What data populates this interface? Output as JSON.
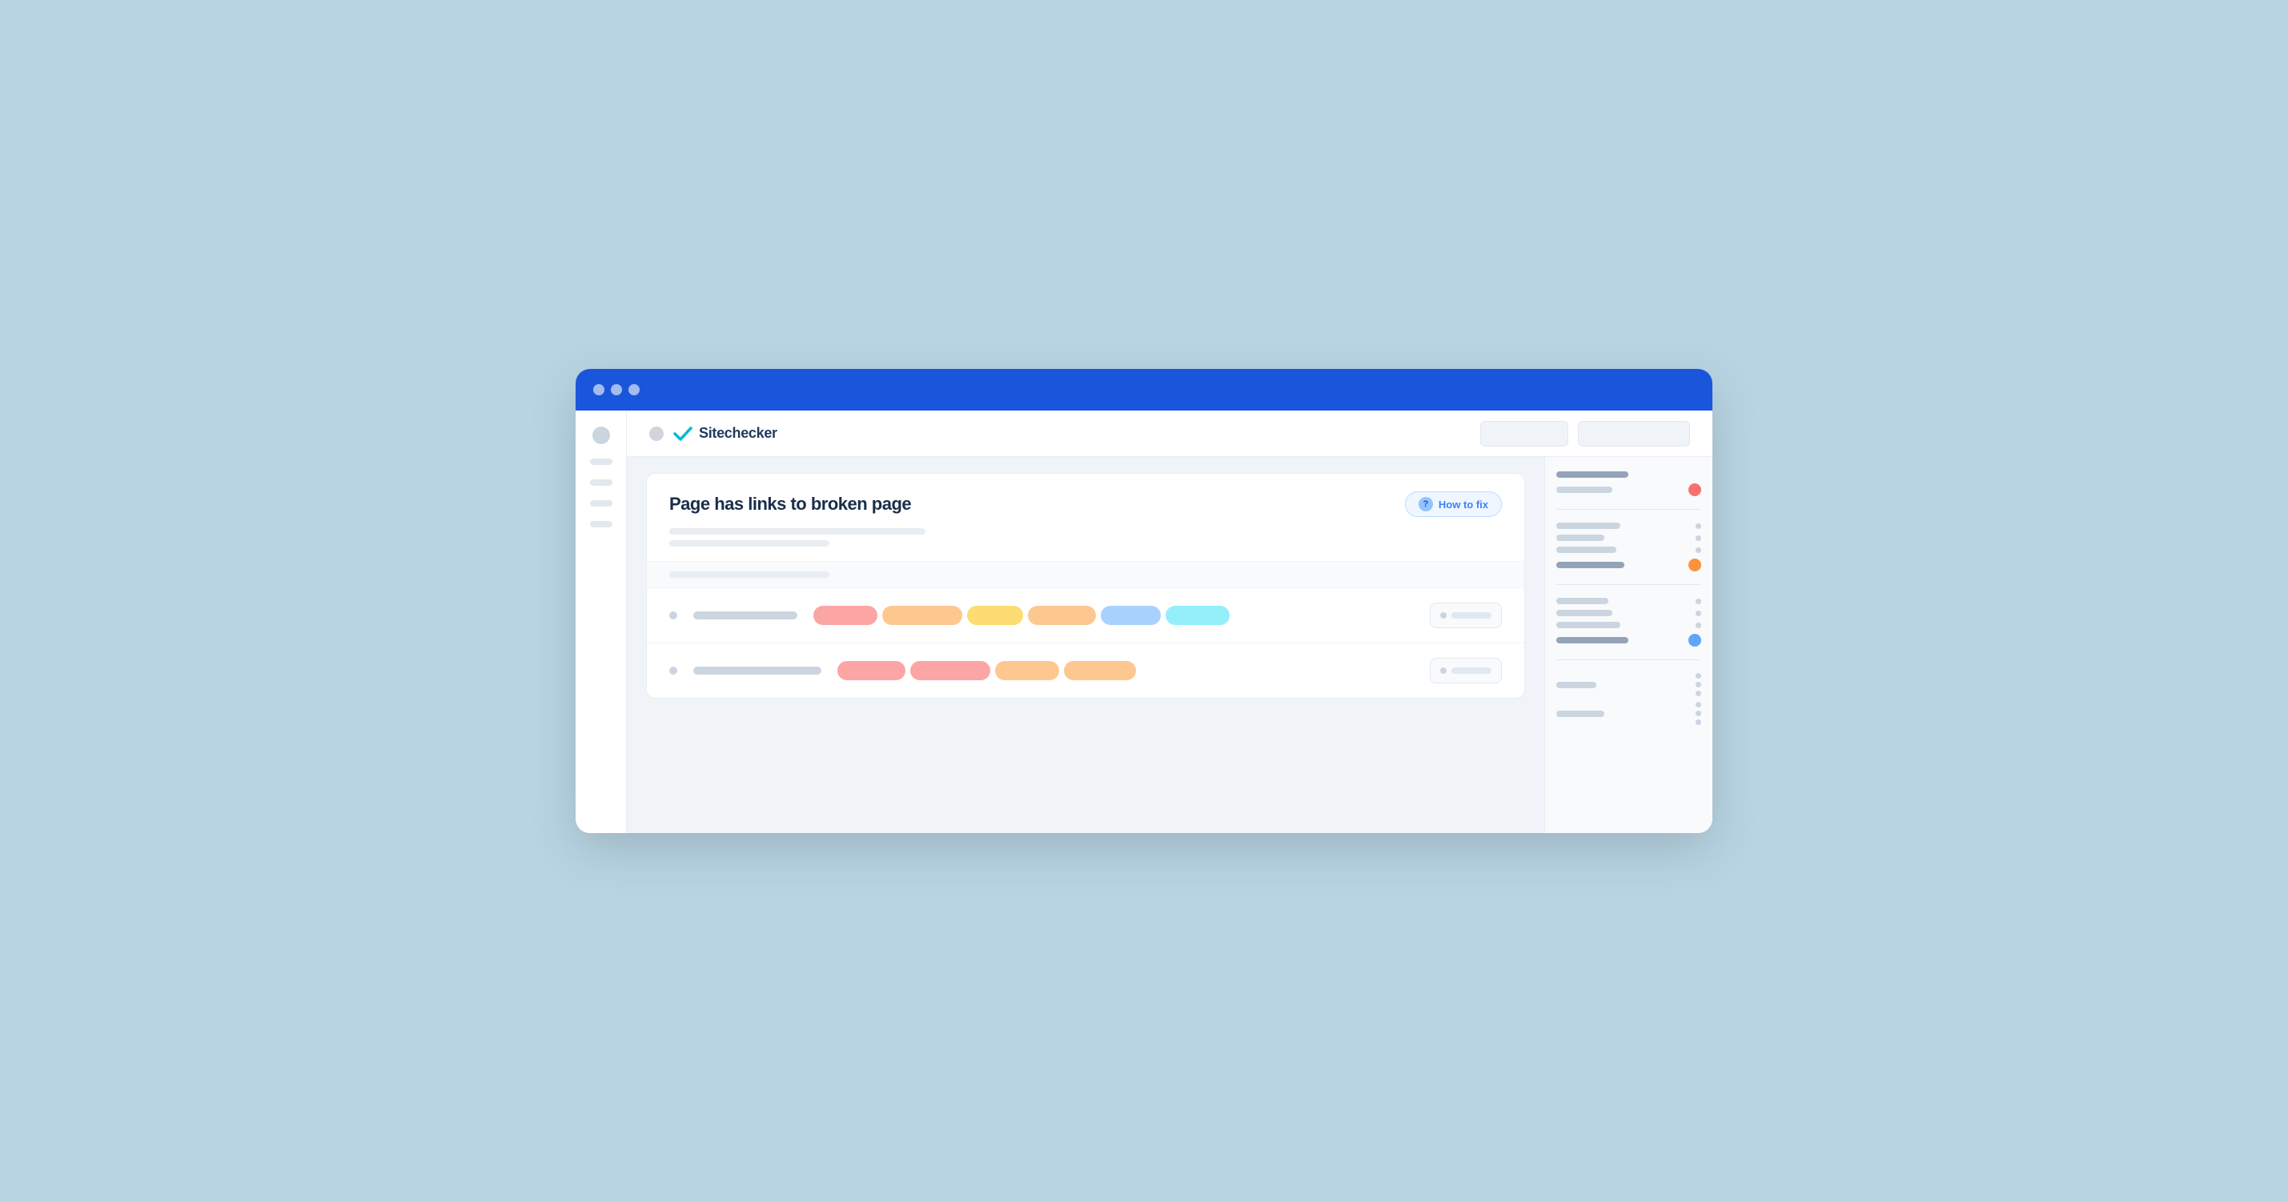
{
  "page": {
    "background": "#b8d4e3"
  },
  "browser": {
    "dots": [
      "dot1",
      "dot2",
      "dot3"
    ]
  },
  "topnav": {
    "logo_text": "Sitechecker",
    "btn1_label": "",
    "btn2_label": ""
  },
  "panel": {
    "title": "Page has links to broken page",
    "how_to_fix_label": "How to fix",
    "how_to_fix_icon": "?",
    "desc_line1": "",
    "desc_line2": ""
  },
  "table": {
    "rows": [
      {
        "id": "row1",
        "tags": [
          {
            "color": "pink",
            "width": "w80"
          },
          {
            "color": "peach",
            "width": "w100"
          },
          {
            "color": "orange",
            "width": "w70"
          },
          {
            "color": "peach",
            "width": "w85"
          },
          {
            "color": "blue",
            "width": "w75"
          },
          {
            "color": "cyan",
            "width": "w80"
          }
        ]
      },
      {
        "id": "row2",
        "tags": [
          {
            "color": "pink",
            "width": "w85"
          },
          {
            "color": "pink",
            "width": "w100"
          },
          {
            "color": "peach",
            "width": "w80"
          },
          {
            "color": "peach",
            "width": "w90"
          }
        ]
      }
    ]
  },
  "sidebar_right": {
    "groups": [
      {
        "id": "g1",
        "rows": [
          {
            "bar_width": "w90",
            "bar_style": "dark",
            "status": "none",
            "dots": 0
          },
          {
            "bar_width": "w70",
            "bar_style": "",
            "status": "red",
            "dots": 0
          }
        ]
      },
      {
        "id": "g2",
        "rows": [
          {
            "bar_width": "w80",
            "bar_style": "",
            "status": "none",
            "dots": 1
          },
          {
            "bar_width": "w60",
            "bar_style": "",
            "status": "none",
            "dots": 1
          },
          {
            "bar_width": "w75",
            "bar_style": "",
            "status": "none",
            "dots": 1
          },
          {
            "bar_width": "w85",
            "bar_style": "dark",
            "status": "orange",
            "dots": 0
          }
        ]
      },
      {
        "id": "g3",
        "rows": [
          {
            "bar_width": "w65",
            "bar_style": "",
            "status": "none",
            "dots": 1
          },
          {
            "bar_width": "w70",
            "bar_style": "",
            "status": "none",
            "dots": 1
          },
          {
            "bar_width": "w80",
            "bar_style": "",
            "status": "none",
            "dots": 1
          },
          {
            "bar_width": "w90",
            "bar_style": "dark",
            "status": "blue",
            "dots": 0
          }
        ]
      },
      {
        "id": "g4",
        "rows": [
          {
            "bar_width": "w50",
            "bar_style": "",
            "status": "none",
            "dots": 1
          },
          {
            "bar_width": "w60",
            "bar_style": "",
            "status": "none",
            "dots": 1
          }
        ]
      }
    ]
  }
}
